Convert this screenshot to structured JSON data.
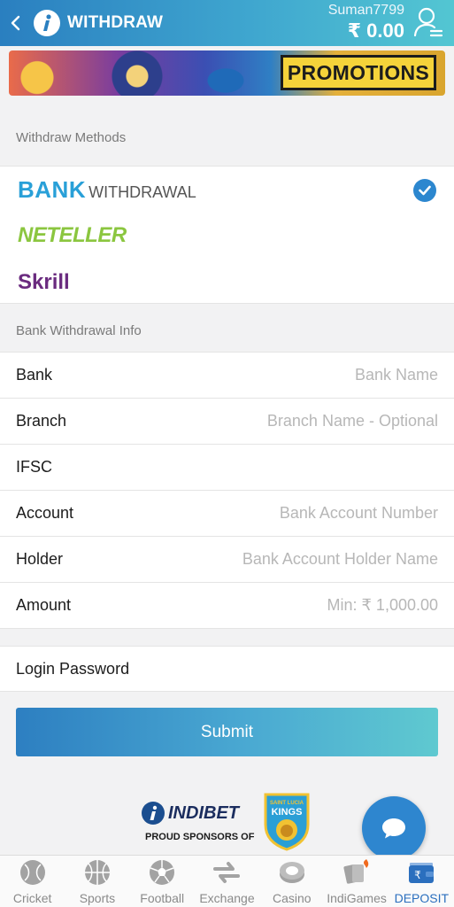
{
  "header": {
    "title": "WITHDRAW",
    "username": "Suman7799",
    "balance": "₹ 0.00",
    "colors": {
      "gradient_start": "#2a7fc0",
      "gradient_end": "#53c6d2"
    }
  },
  "banner": {
    "label": "PROMOTIONS"
  },
  "withdraw_methods": {
    "heading": "Withdraw Methods",
    "items": [
      {
        "brand": "BANK",
        "suffix": "WITHDRAWAL",
        "selected": true
      },
      {
        "brand": "NETELLER",
        "selected": false
      },
      {
        "brand": "Skrill",
        "selected": false
      }
    ]
  },
  "bank_info": {
    "heading": "Bank Withdrawal Info",
    "fields": [
      {
        "label": "Bank",
        "placeholder": "Bank Name",
        "value": ""
      },
      {
        "label": "Branch",
        "placeholder": "Branch Name - Optional",
        "value": ""
      },
      {
        "label": "IFSC",
        "placeholder": "",
        "value": ""
      },
      {
        "label": "Account",
        "placeholder": "Bank Account Number",
        "value": ""
      },
      {
        "label": "Holder",
        "placeholder": "Bank Account Holder Name",
        "value": ""
      },
      {
        "label": "Amount",
        "placeholder": "Min: ₹ 1,000.00",
        "value": ""
      }
    ],
    "password_label": "Login Password"
  },
  "submit_label": "Submit",
  "sponsor": {
    "brand": "INDIBET",
    "text": "PROUD SPONSORS OF",
    "team_top": "SAINT LUCIA",
    "team": "KINGS"
  },
  "bottom_nav": [
    {
      "label": "Cricket",
      "icon": "cricket-ball-icon"
    },
    {
      "label": "Sports",
      "icon": "basketball-icon"
    },
    {
      "label": "Football",
      "icon": "football-icon"
    },
    {
      "label": "Exchange",
      "icon": "exchange-icon"
    },
    {
      "label": "Casino",
      "icon": "casino-chip-icon"
    },
    {
      "label": "IndiGames",
      "icon": "cards-icon"
    },
    {
      "label": "DEPOSIT",
      "icon": "wallet-icon"
    }
  ]
}
